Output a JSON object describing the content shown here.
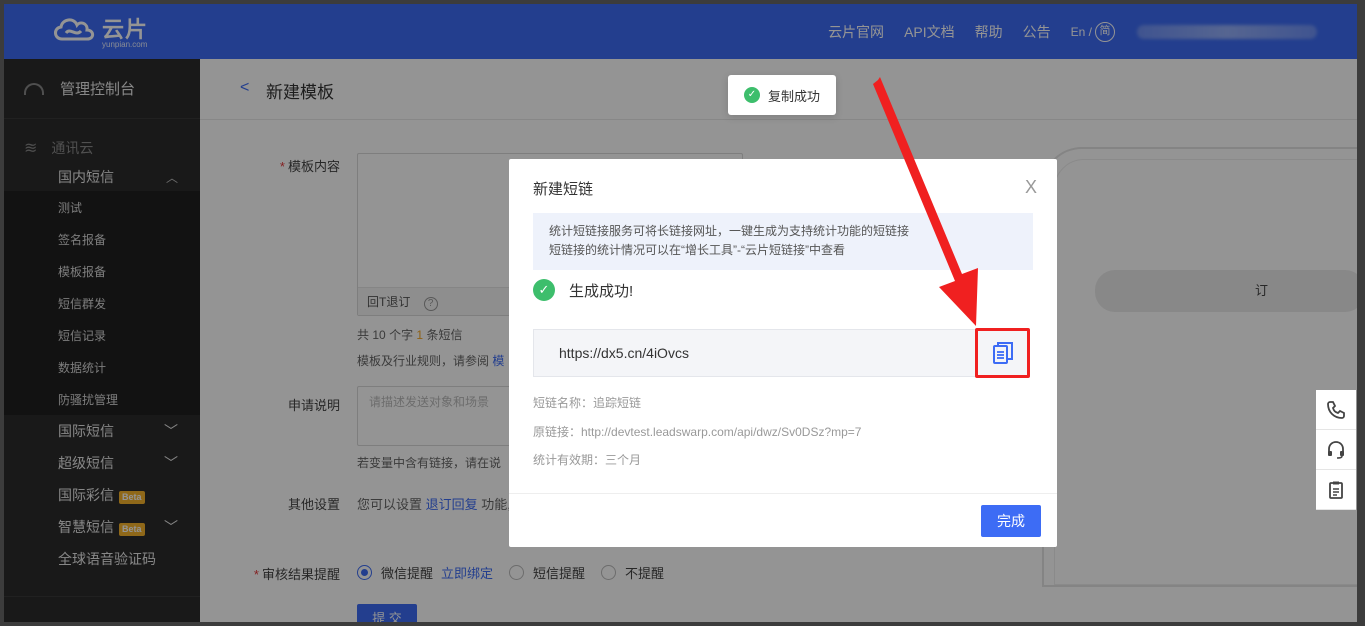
{
  "header": {
    "logo_text": "云片",
    "logo_sub": "yunpian.com",
    "nav": [
      "云片官网",
      "API文档",
      "帮助",
      "公告"
    ],
    "lang_en": "En /",
    "lang_zh": "简"
  },
  "sidebar": {
    "console": "管理控制台",
    "group": "通讯云",
    "domestic": "国内短信",
    "leaves": [
      "测试",
      "签名报备",
      "模板报备",
      "短信群发",
      "短信记录",
      "数据统计",
      "防骚扰管理"
    ],
    "intl": "国际短信",
    "super": "超级短信",
    "intl_mms": "国际彩信",
    "smart": "智慧短信",
    "beta": "Beta",
    "voice": "全球语音验证码"
  },
  "page": {
    "back": "<",
    "title": "新建模板"
  },
  "form": {
    "content_label": "模板内容",
    "unsub": "回T退订",
    "help": "?",
    "count_pre": "共",
    "count_num1": "10",
    "count_mid": "个字",
    "count_num2": "1",
    "count_post": "条短信",
    "rules_note": "模板及行业规则，请参阅",
    "rules_link": "模",
    "apply_label": "申请说明",
    "apply_placeholder": "请描述发送对象和场景",
    "var_note": "若变量中含有链接，请在说",
    "other_label": "其他设置",
    "other_note_pre": "您可以设置",
    "other_note_link": "退订回复",
    "other_note_post": "功能,",
    "review_label": "审核结果提醒",
    "opt_wechat": "微信提醒",
    "bind_now": "立即绑定",
    "opt_sms": "短信提醒",
    "opt_none": "不提醒",
    "submit": "提 交"
  },
  "phone": {
    "bubble": "订"
  },
  "toast": {
    "text": "复制成功"
  },
  "modal": {
    "title": "新建短链",
    "close": "X",
    "tip_line1": "统计短链接服务可将长链接网址，一键生成为支持统计功能的短链接",
    "tip_line2": "短链接的统计情况可以在“增长工具”-“云片短链接”中查看",
    "success": "生成成功!",
    "short_url": "https://dx5.cn/4iOvcs",
    "name_line": "短链名称：追踪短链",
    "origin_line": "原链接：http://devtest.leadswarp.com/api/dwz/Sv0DSz?mp=7",
    "valid_line": "统计有效期：三个月",
    "done": "完成"
  },
  "colors": {
    "brand": "#3d6cf5",
    "success": "#3dbe6c",
    "highlight": "#f02020"
  },
  "icons": {
    "float_tools": [
      "phone-icon",
      "headset-icon",
      "clipboard-icon"
    ],
    "copy": "copy-icon"
  }
}
